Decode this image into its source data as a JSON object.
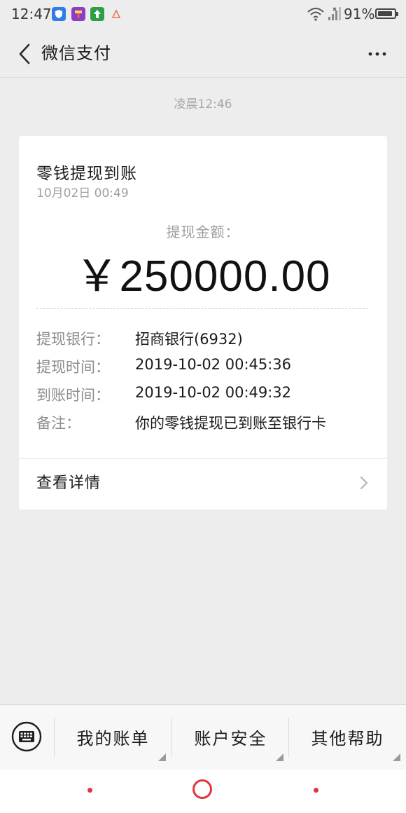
{
  "status_bar": {
    "time": "12:47",
    "battery_percent": "91%",
    "battery_level": 0.91,
    "app_icons": [
      "shield-app-icon",
      "tools-app-icon",
      "upload-app-icon",
      "warning-app-icon"
    ]
  },
  "title_bar": {
    "title": "微信支付"
  },
  "message": {
    "time": "凌晨12:46"
  },
  "card": {
    "title": "零钱提现到账",
    "date": "10月02日 00:49",
    "amount_label": "提现金额：",
    "amount_value": "￥250000.00",
    "rows": [
      {
        "label": "提现银行：",
        "value": "招商银行(6932)"
      },
      {
        "label": "提现时间：",
        "value": "2019-10-02 00:45:36"
      },
      {
        "label": "到账时间：",
        "value": "2019-10-02 00:49:32"
      },
      {
        "label": "备注：",
        "value": "你的零钱提现已到账至银行卡"
      }
    ],
    "detail_link": "查看详情"
  },
  "bottom_menu": {
    "items": [
      "我的账单",
      "账户安全",
      "其他帮助"
    ]
  },
  "colors": {
    "background": "#ededed",
    "card": "#ffffff",
    "nav_accent": "#e0363a"
  }
}
